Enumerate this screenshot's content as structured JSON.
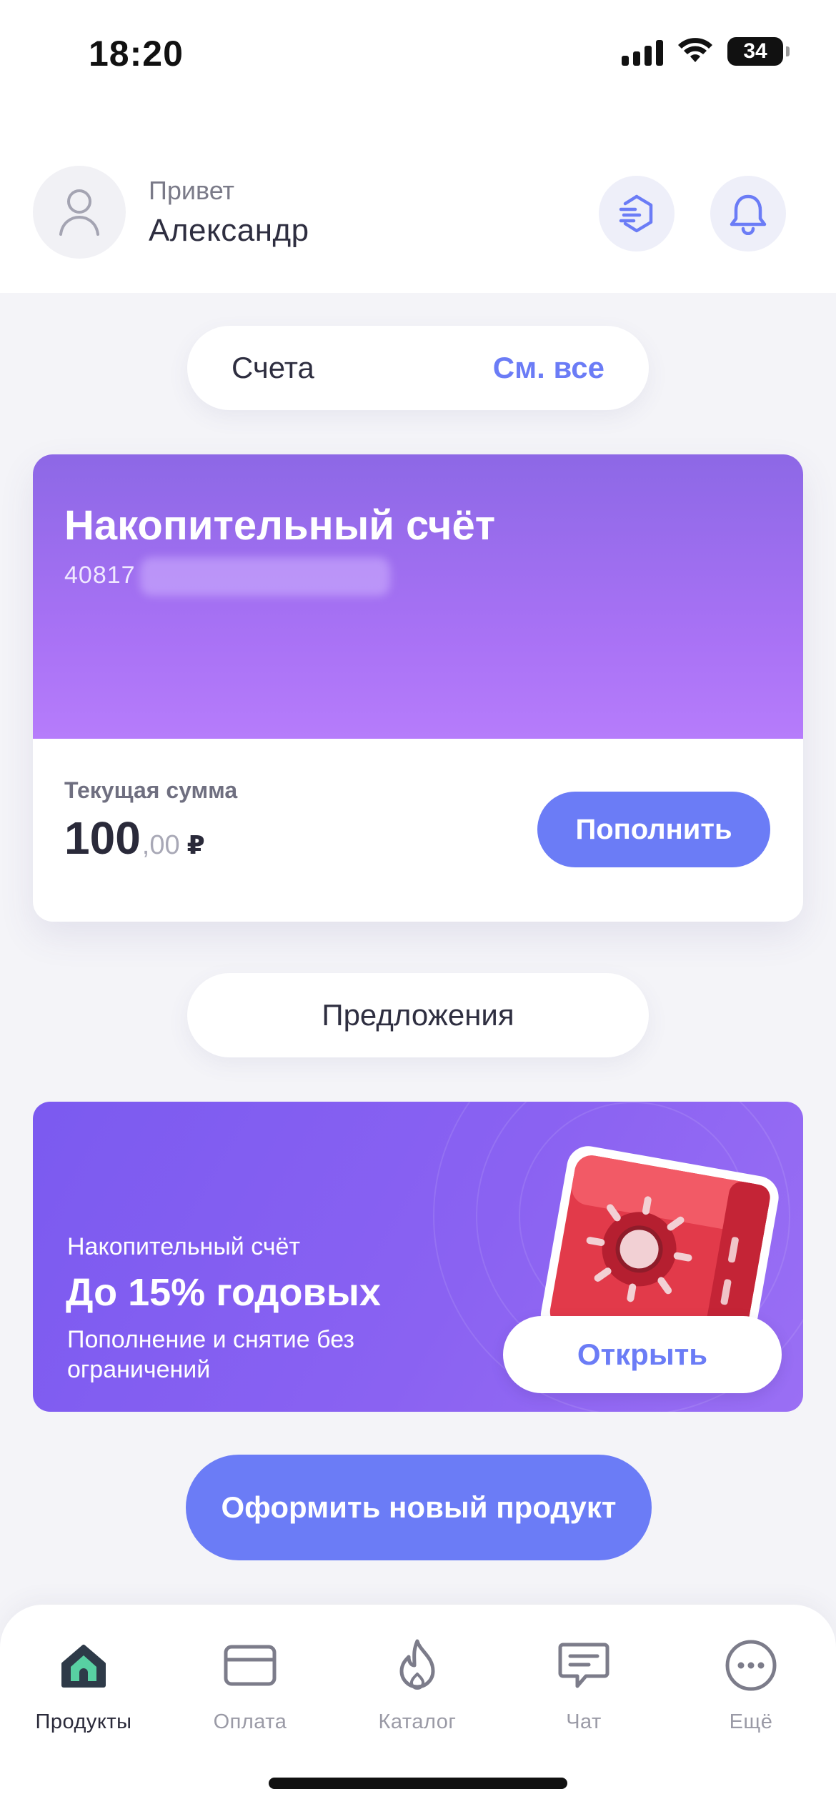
{
  "status_bar": {
    "time": "18:20",
    "battery": "34"
  },
  "header": {
    "greeting": "Привет",
    "user_name": "Александр"
  },
  "accounts_section": {
    "title": "Счета",
    "see_all": "См. все"
  },
  "account_card": {
    "title": "Накопительный счёт",
    "number_prefix": "40817",
    "sum_label": "Текущая сумма",
    "sum_main": "100",
    "sum_cents": ",00",
    "currency": "₽",
    "refill_button": "Пополнить"
  },
  "offers_section": {
    "title": "Предложения"
  },
  "offer_banner": {
    "subtitle": "Накопительный счёт",
    "title": "До 15% годовых",
    "description": "Пополнение и снятие без ограничений",
    "open_button": "Открыть"
  },
  "new_product_button": "Оформить новый продукт",
  "bottom_nav": {
    "items": [
      {
        "label": "Продукты",
        "icon": "home-icon",
        "active": true
      },
      {
        "label": "Оплата",
        "icon": "card-icon",
        "active": false
      },
      {
        "label": "Каталог",
        "icon": "flame-icon",
        "active": false
      },
      {
        "label": "Чат",
        "icon": "chat-icon",
        "active": false
      },
      {
        "label": "Ещё",
        "icon": "more-icon",
        "active": false
      }
    ]
  },
  "colors": {
    "accent": "#6b7cf6",
    "card_gradient_top": "#8d68e6",
    "card_gradient_bottom": "#b67cfb",
    "offer_background": "#7b5af0"
  }
}
